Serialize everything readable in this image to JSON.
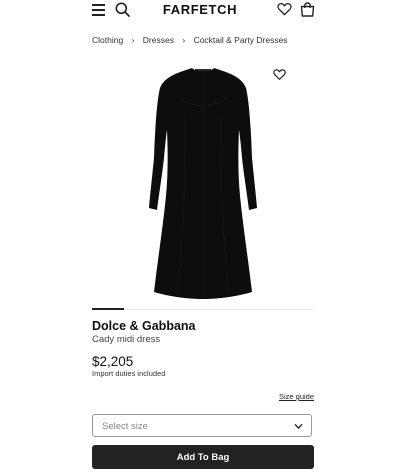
{
  "header": {
    "logo": "FARFETCH",
    "icons": [
      "menu-icon",
      "search-icon",
      "heart-icon",
      "bag-icon"
    ]
  },
  "breadcrumb": {
    "items": [
      "Clothing",
      "Dresses",
      "Cocktail & Party Dresses"
    ],
    "separator": "›"
  },
  "product": {
    "brand": "Dolce & Gabbana",
    "name": "Cady midi dress",
    "price": "$2,205",
    "duties_note": "Import duties included",
    "image_color": "#0d0d0d"
  },
  "gallery": {
    "active_index": 0
  },
  "size": {
    "guide_label": "Size guide",
    "placeholder": "Select size"
  },
  "actions": {
    "add_to_bag": "Add To Bag"
  },
  "colors": {
    "text": "#222222",
    "button_bg": "#222222",
    "button_text": "#ffffff",
    "border": "#999999"
  }
}
